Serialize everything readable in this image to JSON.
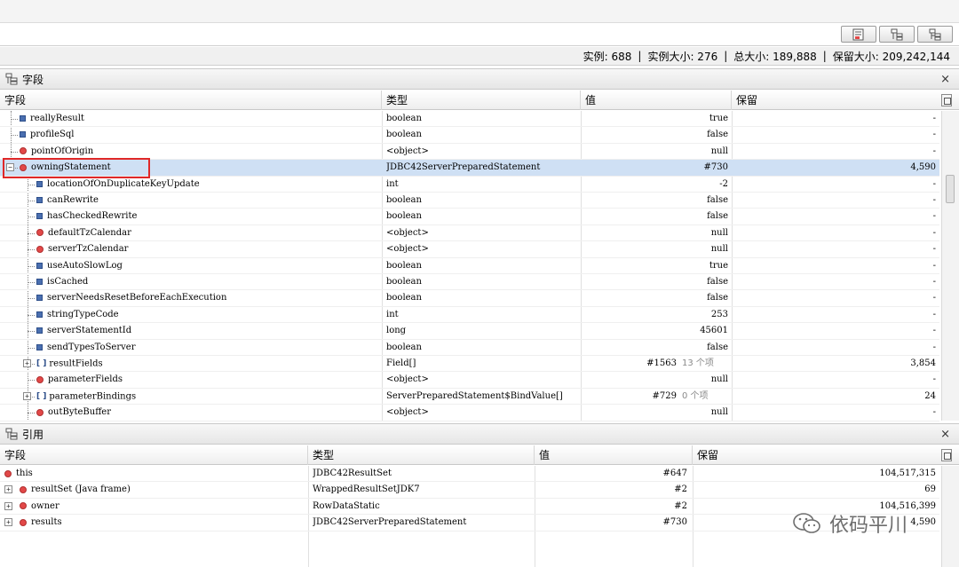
{
  "status": {
    "instances": "实例: 688",
    "instance_size": "实例大小: 276",
    "total_size": "总大小: 189,888",
    "retained_size": "保留大小: 209,242,144",
    "sep": "|"
  },
  "fields_panel": {
    "title": "字段",
    "close": "×",
    "columns": [
      "字段",
      "类型",
      "值",
      "保留"
    ],
    "rows": [
      {
        "name": "reallyResult",
        "type": "boolean",
        "value": "true",
        "count": "",
        "retained": "-",
        "icon": "primitive-icon",
        "level": 0
      },
      {
        "name": "profileSql",
        "type": "boolean",
        "value": "false",
        "count": "",
        "retained": "-",
        "icon": "primitive-icon",
        "level": 0
      },
      {
        "name": "pointOfOrigin",
        "type": "<object>",
        "value": "null",
        "count": "",
        "retained": "-",
        "icon": "object-icon",
        "level": 0
      },
      {
        "name": "owningStatement",
        "type": "JDBC42ServerPreparedStatement",
        "value": "#730",
        "count": "",
        "retained": "4,590",
        "icon": "object-icon",
        "level": 0,
        "expanded": true,
        "selected": true
      },
      {
        "name": "locationOfOnDuplicateKeyUpdate",
        "type": "int",
        "value": "-2",
        "count": "",
        "retained": "-",
        "icon": "primitive-icon",
        "level": 1
      },
      {
        "name": "canRewrite",
        "type": "boolean",
        "value": "false",
        "count": "",
        "retained": "-",
        "icon": "primitive-icon",
        "level": 1
      },
      {
        "name": "hasCheckedRewrite",
        "type": "boolean",
        "value": "false",
        "count": "",
        "retained": "-",
        "icon": "primitive-icon",
        "level": 1
      },
      {
        "name": "defaultTzCalendar",
        "type": "<object>",
        "value": "null",
        "count": "",
        "retained": "-",
        "icon": "object-icon",
        "level": 1
      },
      {
        "name": "serverTzCalendar",
        "type": "<object>",
        "value": "null",
        "count": "",
        "retained": "-",
        "icon": "object-icon",
        "level": 1
      },
      {
        "name": "useAutoSlowLog",
        "type": "boolean",
        "value": "true",
        "count": "",
        "retained": "-",
        "icon": "primitive-icon",
        "level": 1
      },
      {
        "name": "isCached",
        "type": "boolean",
        "value": "false",
        "count": "",
        "retained": "-",
        "icon": "primitive-icon",
        "level": 1
      },
      {
        "name": "serverNeedsResetBeforeEachExecution",
        "type": "boolean",
        "value": "false",
        "count": "",
        "retained": "-",
        "icon": "primitive-icon",
        "level": 1
      },
      {
        "name": "stringTypeCode",
        "type": "int",
        "value": "253",
        "count": "",
        "retained": "-",
        "icon": "primitive-icon",
        "level": 1
      },
      {
        "name": "serverStatementId",
        "type": "long",
        "value": "45601",
        "count": "",
        "retained": "-",
        "icon": "primitive-icon",
        "level": 1
      },
      {
        "name": "sendTypesToServer",
        "type": "boolean",
        "value": "false",
        "count": "",
        "retained": "-",
        "icon": "primitive-icon",
        "level": 1
      },
      {
        "name": "resultFields",
        "type": "Field[]",
        "value": "#1563",
        "count": "13 个项",
        "retained": "3,854",
        "icon": "array-icon",
        "level": 1,
        "collapsed": true
      },
      {
        "name": "parameterFields",
        "type": "<object>",
        "value": "null",
        "count": "",
        "retained": "-",
        "icon": "object-icon",
        "level": 1
      },
      {
        "name": "parameterBindings",
        "type": "ServerPreparedStatement$BindValue[]",
        "value": "#729",
        "count": "0 个项",
        "retained": "24",
        "icon": "array-icon",
        "level": 1,
        "collapsed": true
      },
      {
        "name": "outByteBuffer",
        "type": "<object>",
        "value": "null",
        "count": "",
        "retained": "-",
        "icon": "object-icon",
        "level": 1
      }
    ]
  },
  "refs_panel": {
    "title": "引用",
    "close": "×",
    "columns": [
      "字段",
      "类型",
      "值",
      "保留"
    ],
    "rows": [
      {
        "name": "this",
        "type": "JDBC42ResultSet",
        "value": "#647",
        "retained": "104,517,315",
        "expander": false
      },
      {
        "name": "resultSet (Java frame)",
        "type": "WrappedResultSetJDK7",
        "value": "#2",
        "retained": "69",
        "expander": true
      },
      {
        "name": "owner",
        "type": "RowDataStatic",
        "value": "#2",
        "retained": "104,516,399",
        "expander": true
      },
      {
        "name": "results",
        "type": "JDBC42ServerPreparedStatement",
        "value": "#730",
        "retained": "4,590",
        "expander": true
      }
    ]
  },
  "watermark": "依码平川",
  "colors": {
    "selection": "#cfe0f4",
    "highlight": "#e02828"
  }
}
